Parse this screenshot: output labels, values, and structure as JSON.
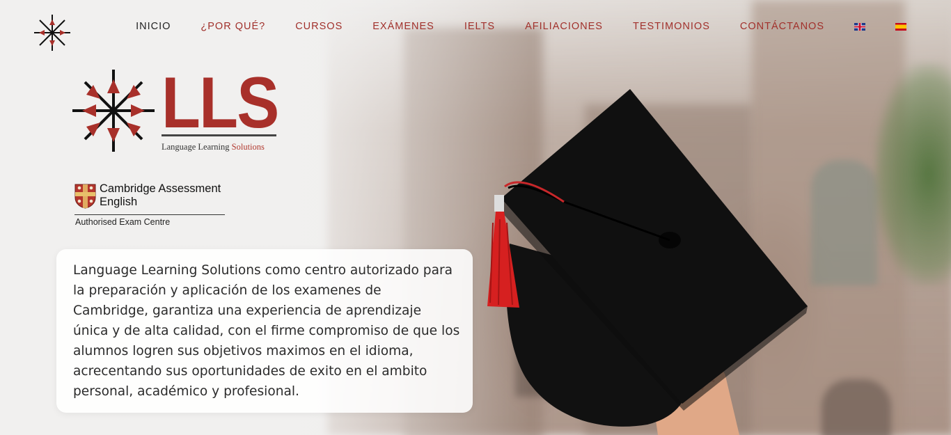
{
  "header": {
    "logo_icon": "lls-compass-icon",
    "nav": [
      {
        "label": "INICIO",
        "active": true
      },
      {
        "label": "¿POR QUÉ?",
        "active": false
      },
      {
        "label": "CURSOS",
        "active": false
      },
      {
        "label": "EXÁMENES",
        "active": false
      },
      {
        "label": "IELTS",
        "active": false
      },
      {
        "label": "AFILIACIONES",
        "active": false
      },
      {
        "label": "TESTIMONIOS",
        "active": false
      },
      {
        "label": "CONTÁCTANOS",
        "active": false
      }
    ],
    "languages": [
      {
        "name": "English",
        "icon": "uk-flag-icon"
      },
      {
        "name": "Español",
        "icon": "spain-flag-icon"
      }
    ]
  },
  "brand": {
    "letters": "LLS",
    "tagline_main": "Language Learning ",
    "tagline_accent": "Solutions",
    "accent_color": "#a8302a"
  },
  "cambridge": {
    "title_line1": "Cambridge Assessment",
    "title_line2": "English",
    "subtitle": "Authorised Exam Centre"
  },
  "intro": {
    "text": "Language Learning Solutions como centro autorizado para la preparación y aplicación de los examenes de Cambridge, garantiza una experiencia de aprendizaje única y de alta calidad, con el firme compromiso de que los alumnos logren sus objetivos maximos en el idioma, acrecentando sus oportunidades de exito en el ambito personal, académico y profesional."
  },
  "hero": {
    "image_subject": "graduation-cap-icon"
  }
}
